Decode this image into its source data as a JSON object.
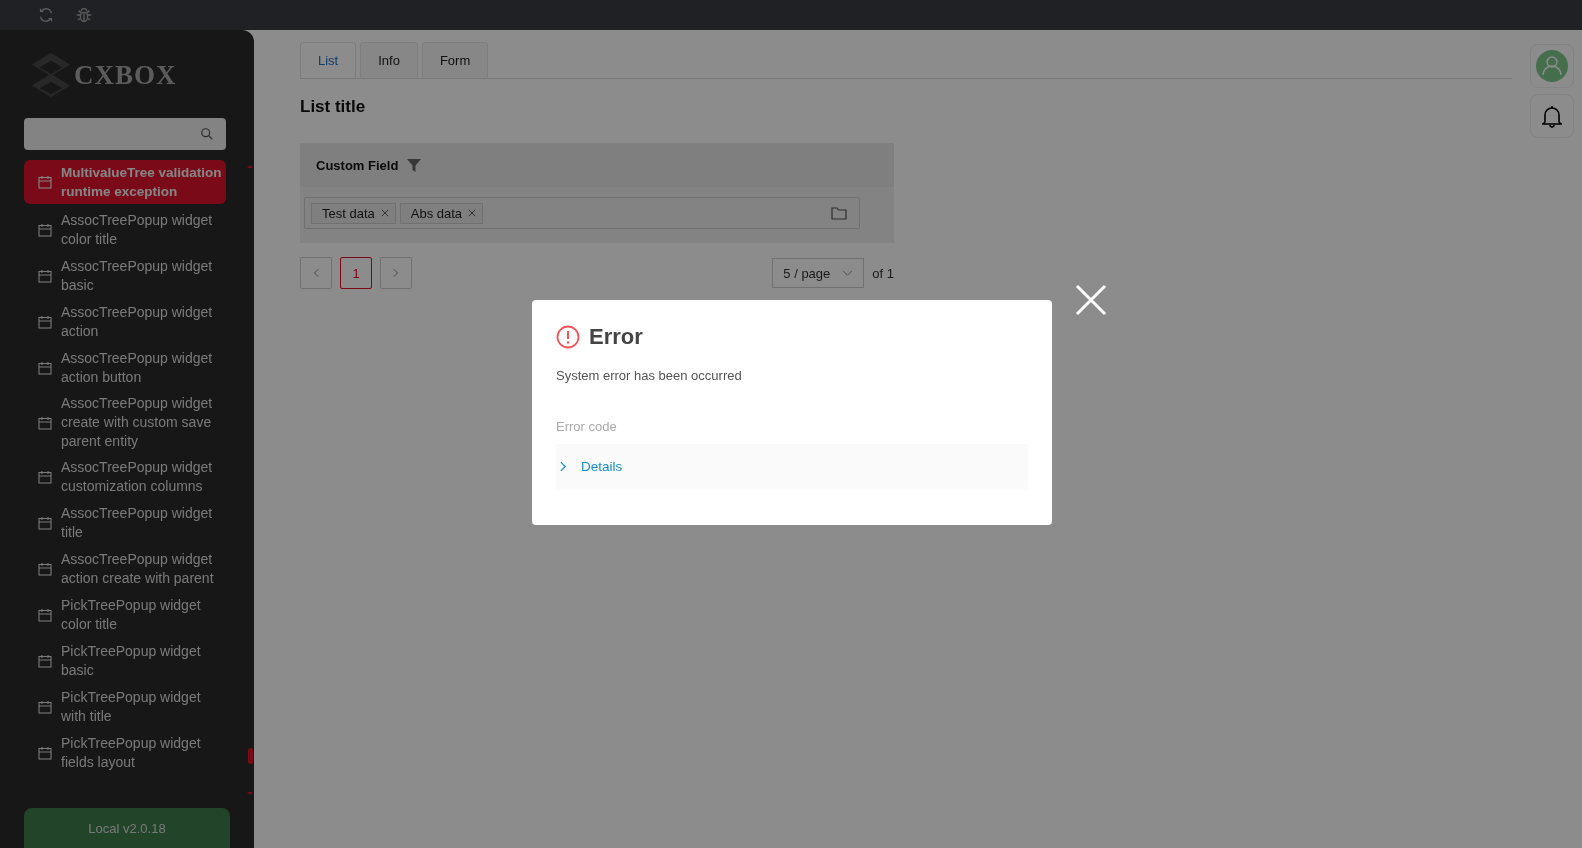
{
  "sidebar": {
    "logo": "CXBOX",
    "items": [
      {
        "label": "MultivalueTree validation runtime exception",
        "selected": true
      },
      {
        "label": "AssocTreePopup widget color title",
        "selected": false
      },
      {
        "label": "AssocTreePopup widget basic",
        "selected": false
      },
      {
        "label": "AssocTreePopup widget action",
        "selected": false
      },
      {
        "label": "AssocTreePopup widget action button",
        "selected": false
      },
      {
        "label": "AssocTreePopup widget create with custom save parent entity",
        "selected": false
      },
      {
        "label": "AssocTreePopup widget customization columns",
        "selected": false
      },
      {
        "label": "AssocTreePopup widget title",
        "selected": false
      },
      {
        "label": "AssocTreePopup widget action create with parent",
        "selected": false
      },
      {
        "label": "PickTreePopup widget color title",
        "selected": false
      },
      {
        "label": "PickTreePopup widget basic",
        "selected": false
      },
      {
        "label": "PickTreePopup widget with title",
        "selected": false
      },
      {
        "label": "PickTreePopup widget fields layout",
        "selected": false
      }
    ],
    "footer": "Local v2.0.18"
  },
  "tabs": [
    {
      "label": "List",
      "selected": true
    },
    {
      "label": "Info",
      "selected": false
    },
    {
      "label": "Form",
      "selected": false
    }
  ],
  "title": "List title",
  "column": {
    "label": "Custom Field"
  },
  "tags": [
    "Test data",
    "Abs data"
  ],
  "pagination": {
    "pages": [
      {
        "label": "1",
        "selected": true
      }
    ],
    "page_size": "5 / page",
    "total": "of 1"
  },
  "modal": {
    "title": "Error",
    "message": "System error has been occurred",
    "code_label": "Error code",
    "details": {
      "label": "Details",
      "expanded": false
    }
  }
}
